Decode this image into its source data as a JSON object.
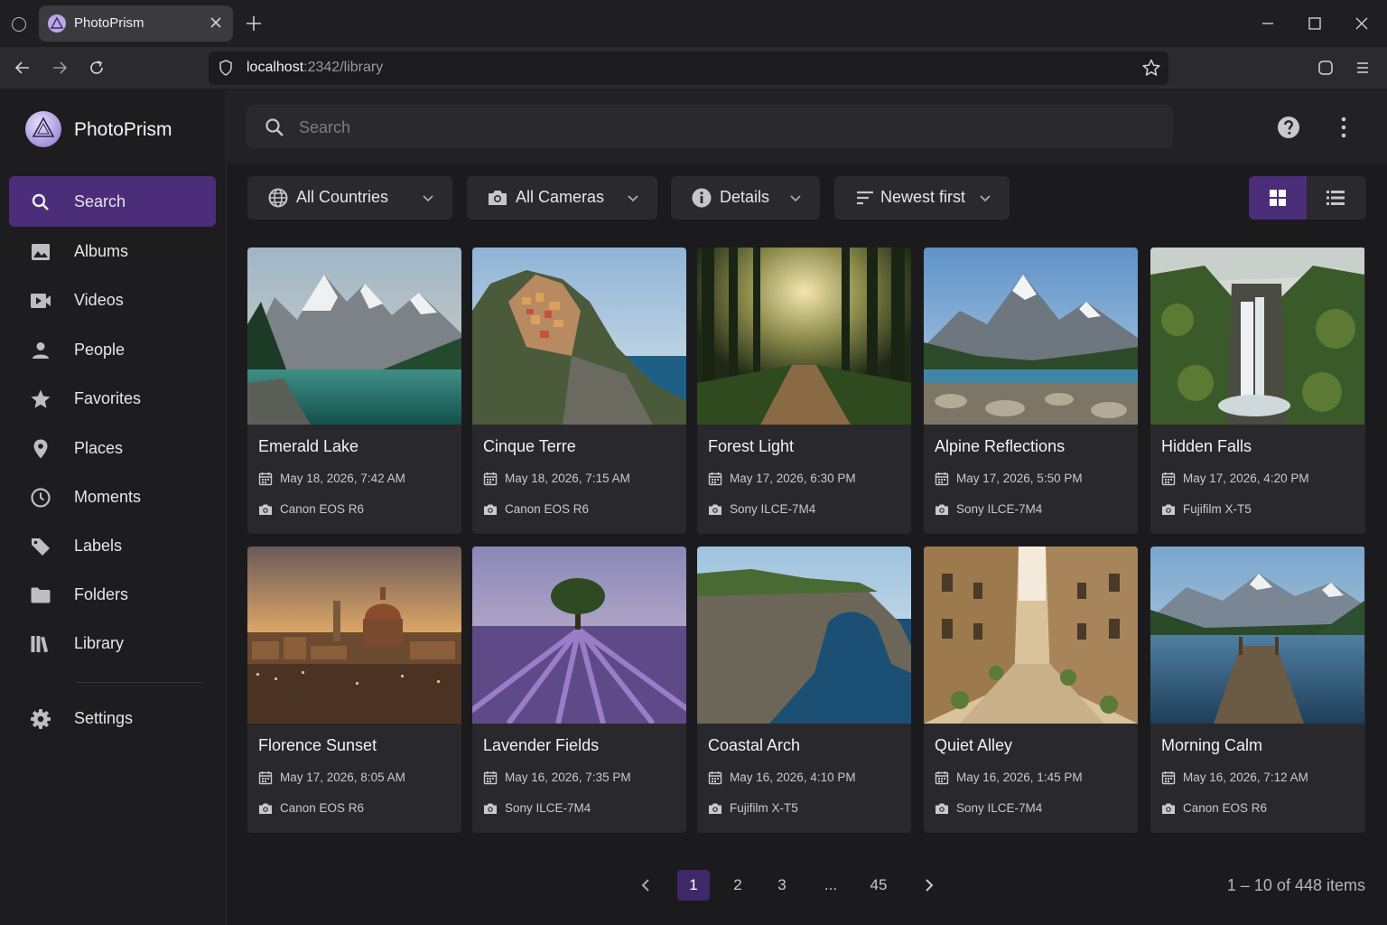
{
  "browser": {
    "tab_title": "PhotoPrism",
    "url_host": "localhost",
    "url_rest": ":2342/library"
  },
  "app": {
    "name": "PhotoPrism",
    "accent": "#4b2d7a",
    "search_placeholder": "Search"
  },
  "sidebar": {
    "items": [
      {
        "label": "Search",
        "icon": "search-icon"
      },
      {
        "label": "Albums",
        "icon": "image-icon"
      },
      {
        "label": "Videos",
        "icon": "video-icon"
      },
      {
        "label": "People",
        "icon": "person-icon"
      },
      {
        "label": "Favorites",
        "icon": "star-icon"
      },
      {
        "label": "Places",
        "icon": "map-pin-icon"
      },
      {
        "label": "Moments",
        "icon": "clock-icon"
      },
      {
        "label": "Labels",
        "icon": "tag-icon"
      },
      {
        "label": "Folders",
        "icon": "folder-icon"
      },
      {
        "label": "Library",
        "icon": "library-icon"
      },
      {
        "label": "Settings",
        "icon": "gear-icon"
      }
    ]
  },
  "filters": {
    "countries": "All Countries",
    "cameras": "All Cameras",
    "details": "Details",
    "sort": "Newest first"
  },
  "photos": [
    {
      "title": "Emerald Lake",
      "date": "May 18, 2026, 7:42 AM",
      "camera": "Canon EOS R6"
    },
    {
      "title": "Cinque Terre",
      "date": "May 18, 2026, 7:15 AM",
      "camera": "Canon EOS R6"
    },
    {
      "title": "Forest Light",
      "date": "May 17, 2026, 6:30 PM",
      "camera": "Sony ILCE-7M4"
    },
    {
      "title": "Alpine Reflections",
      "date": "May 17, 2026, 5:50 PM",
      "camera": "Sony ILCE-7M4"
    },
    {
      "title": "Hidden Falls",
      "date": "May 17, 2026, 4:20 PM",
      "camera": "Fujifilm X-T5"
    },
    {
      "title": "Florence Sunset",
      "date": "May 17, 2026, 8:05 AM",
      "camera": "Canon EOS R6"
    },
    {
      "title": "Lavender Fields",
      "date": "May 16, 2026, 7:35 PM",
      "camera": "Sony ILCE-7M4"
    },
    {
      "title": "Coastal Arch",
      "date": "May 16, 2026, 4:10 PM",
      "camera": "Fujifilm X-T5"
    },
    {
      "title": "Quiet Alley",
      "date": "May 16, 2026, 1:45 PM",
      "camera": "Sony ILCE-7M4"
    },
    {
      "title": "Morning Calm",
      "date": "May 16, 2026, 7:12 AM",
      "camera": "Canon EOS R6"
    }
  ],
  "pagination": {
    "pages": [
      "1",
      "2",
      "3",
      "...",
      "45"
    ],
    "current": "1",
    "summary": "1 – 10 of 448 items"
  }
}
